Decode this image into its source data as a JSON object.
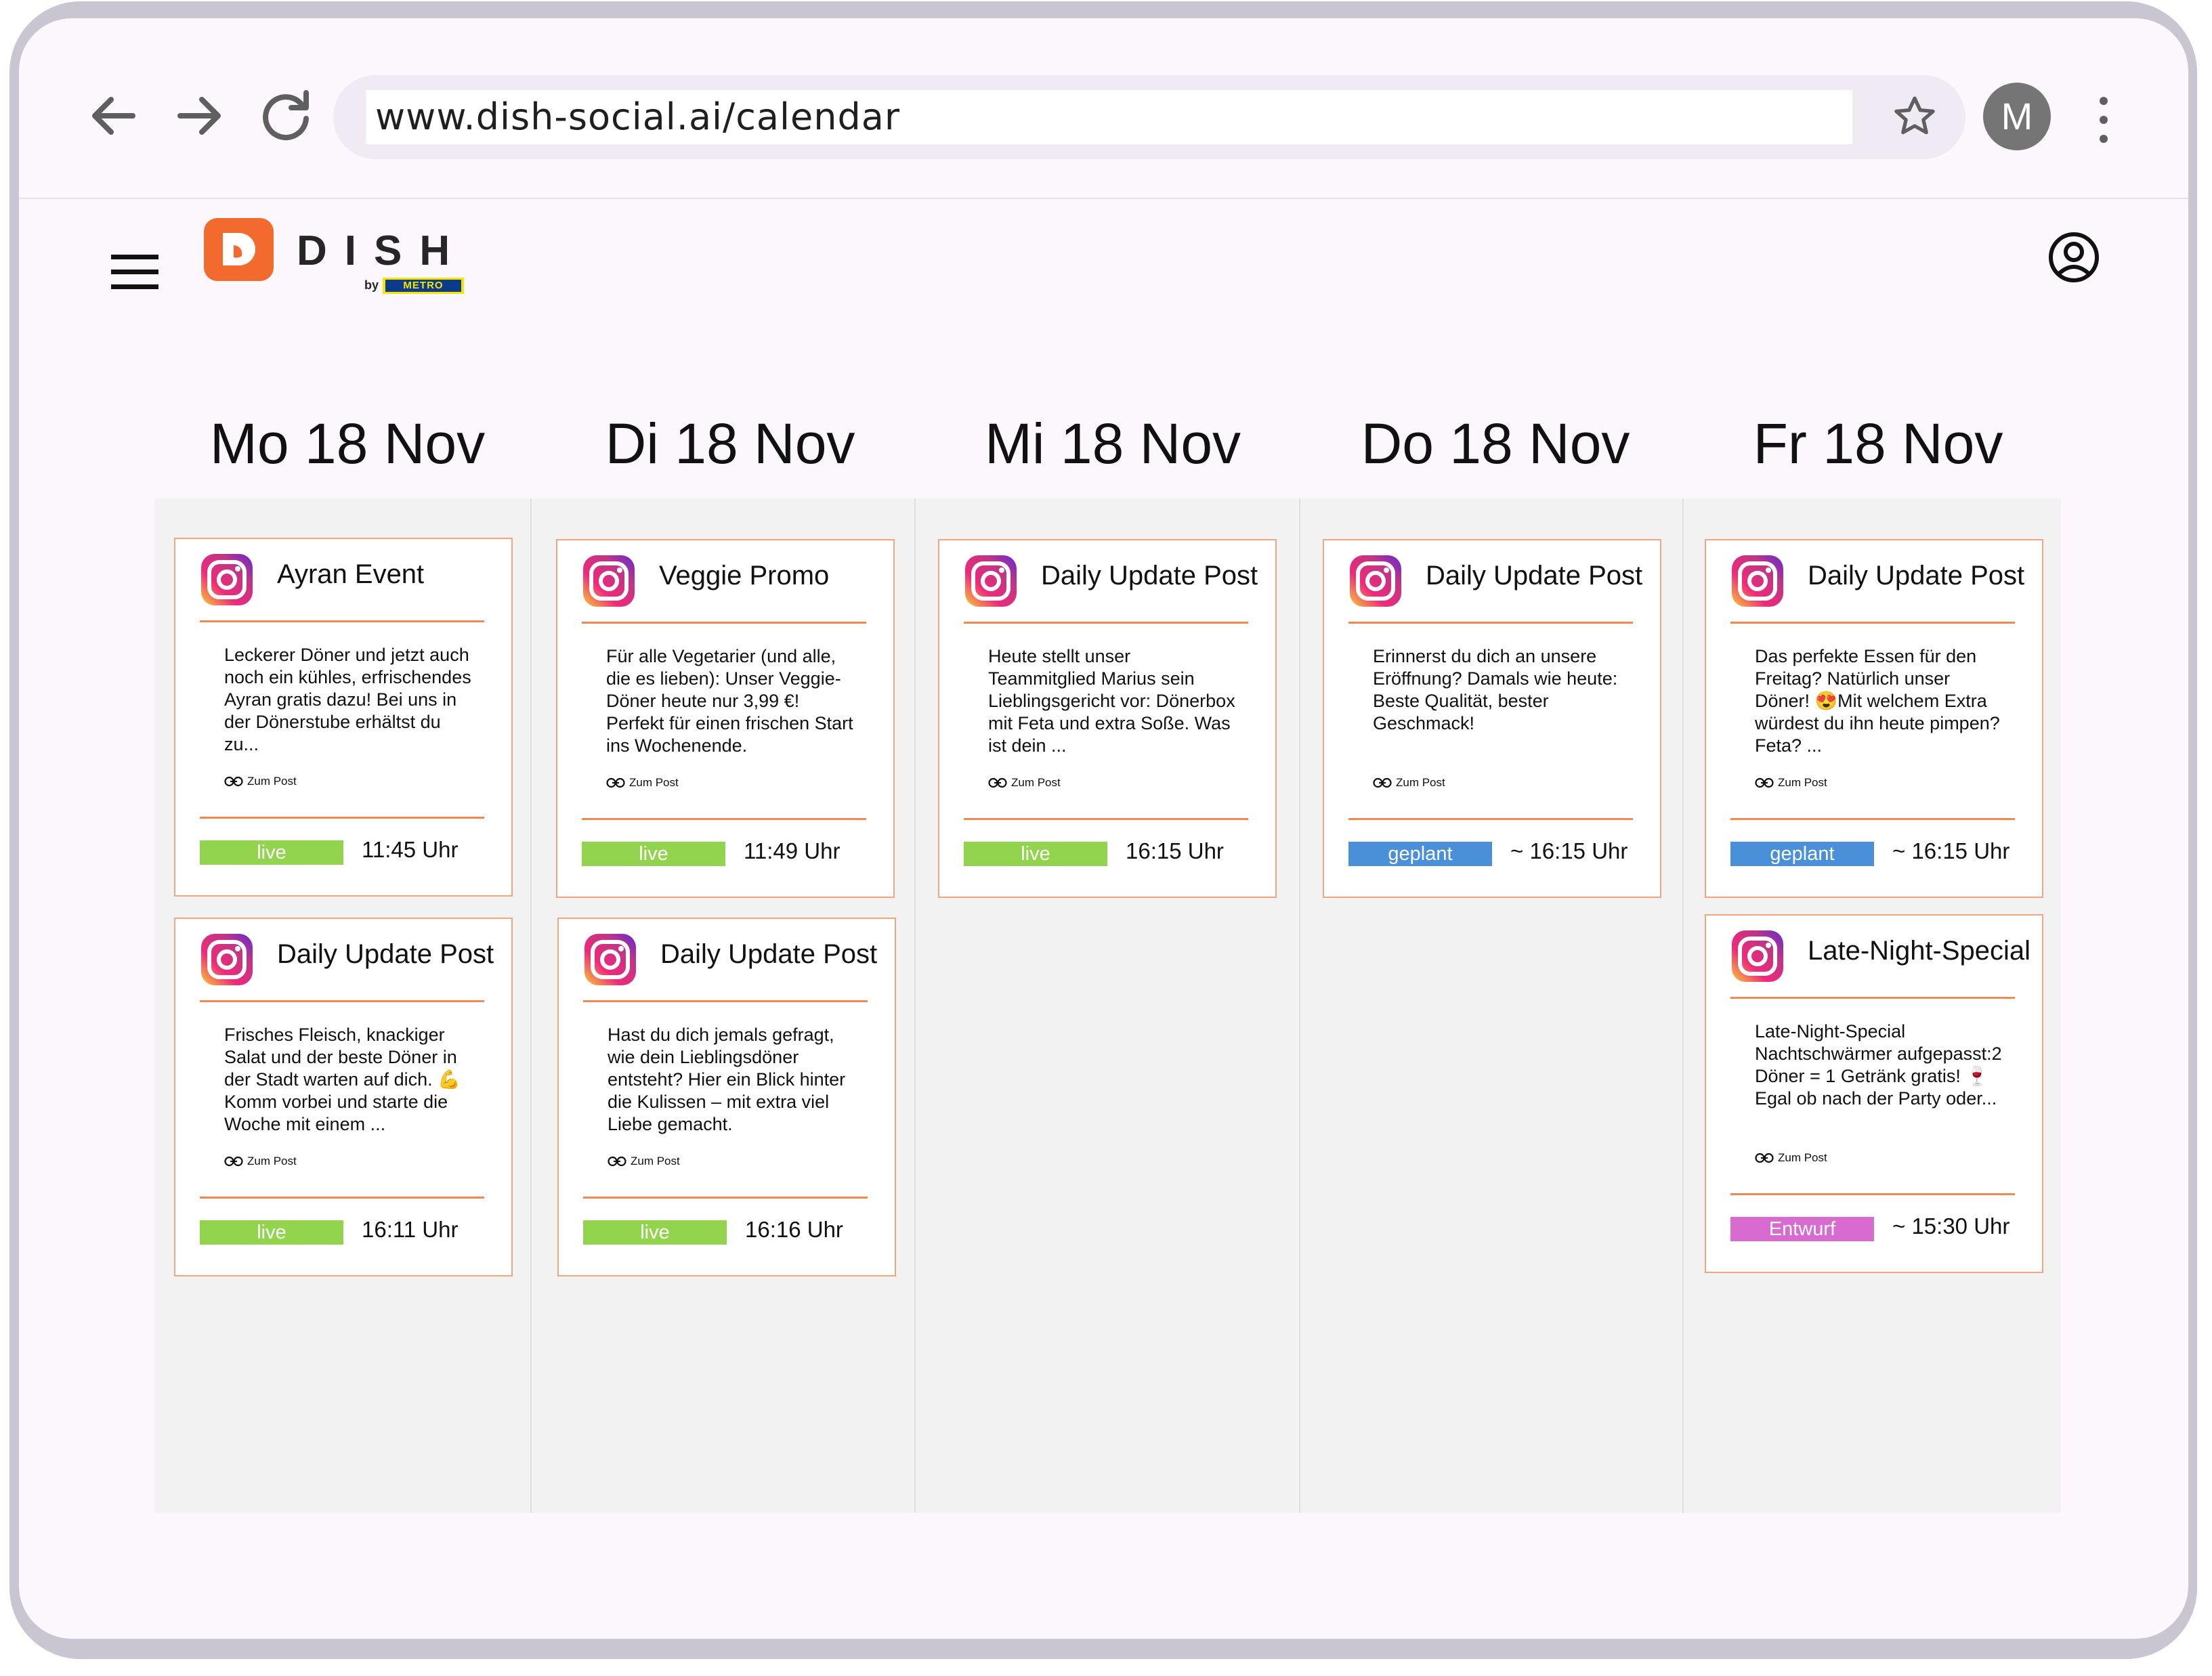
{
  "browser": {
    "url": "www.dish-social.ai/calendar",
    "avatar_letter": "M"
  },
  "app": {
    "logo_text": "DISH",
    "logo_by": "by",
    "logo_partner": "METRO"
  },
  "days": [
    {
      "label": "Mo 18 Nov"
    },
    {
      "label": "Di 18 Nov"
    },
    {
      "label": "Mi 18 Nov"
    },
    {
      "label": "Do 18 Nov"
    },
    {
      "label": "Fr 18 Nov"
    }
  ],
  "status_colors": {
    "live": "#93d44e",
    "geplant": "#4a90d9",
    "Entwurf": "#d96ad0"
  },
  "accent_color": "#f26a2e",
  "cards": [
    {
      "title": "Ayran Event",
      "text": "Leckerer Döner und jetzt auch noch ein kühles, erfrischendes Ayran gratis dazu!  Bei uns in der Dönerstube erhältst du zu...",
      "link": "Zum Post",
      "status": "live",
      "time": "11:45 Uhr"
    },
    {
      "title": "Daily Update Post",
      "text": "Frisches Fleisch, knackiger Salat und der beste Döner in der Stadt warten auf dich. 💪Komm vorbei und starte die Woche mit einem ...",
      "link": "Zum Post",
      "status": "live",
      "time": "16:11 Uhr"
    },
    {
      "title": "Veggie Promo",
      "text": "Für alle Vegetarier (und alle, die es lieben): Unser Veggie-Döner heute nur 3,99 €! Perfekt für einen frischen Start ins Wochenende.",
      "link": "Zum Post",
      "status": "live",
      "time": "11:49 Uhr"
    },
    {
      "title": "Daily Update Post",
      "text": "Hast du dich jemals gefragt, wie dein Lieblingsdöner entsteht? Hier ein Blick hinter die Kulissen – mit extra viel Liebe gemacht.",
      "link": "Zum Post",
      "status": "live",
      "time": "16:16 Uhr"
    },
    {
      "title": "Daily Update Post",
      "text": "Heute stellt unser Teammitglied Marius sein Lieblingsgericht vor: Dönerbox mit Feta und extra Soße. Was ist dein ...",
      "link": "Zum Post",
      "status": "live",
      "time": "16:15 Uhr"
    },
    {
      "title": "Daily Update Post",
      "text": "Erinnerst du dich an unsere Eröffnung? Damals wie heute: Beste Qualität, bester Geschmack!",
      "link": "Zum Post",
      "status": "geplant",
      "time": "~ 16:15 Uhr"
    },
    {
      "title": "Daily Update Post",
      "text": "Das perfekte Essen für den Freitag? Natürlich unser Döner! 😍Mit welchem Extra würdest du ihn heute pimpen? Feta? ...",
      "link": "Zum Post",
      "status": "geplant",
      "time": "~ 16:15 Uhr"
    },
    {
      "title": "Late-Night-Special",
      "text": "Late-Night-Special Nachtschwärmer aufgepasst:2 Döner = 1 Getränk gratis! 🍷Egal ob nach der Party oder...",
      "link": "Zum Post",
      "status": "Entwurf",
      "time": "~ 15:30 Uhr"
    }
  ]
}
